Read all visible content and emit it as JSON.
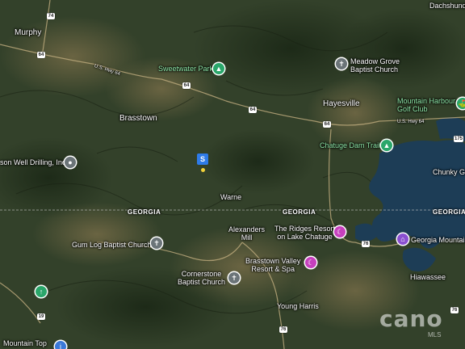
{
  "map": {
    "places": {
      "dachshund": "Dachshund",
      "murphy": "Murphy",
      "brasstown": "Brasstown",
      "hayesville": "Hayesville",
      "warne": "Warne",
      "alexanders_mill": "Alexanders\nMill",
      "young_harris": "Young Harris",
      "hiawassee": "Hiawassee",
      "chunky_gal": "Chunky Ga",
      "mountain_top": "Mountain Top"
    },
    "states": {
      "georgia_left": "GEORGIA",
      "georgia_mid": "GEORGIA",
      "georgia_right": "GEORGIA"
    },
    "roads": {
      "us64_left": "U.S. Hwy 64",
      "us64_right": "U.S. Hwy 64",
      "shield_74": "74",
      "shield_64a": "64",
      "shield_64b": "64",
      "shield_64c": "64",
      "shield_64d": "64",
      "shield_175": "175",
      "shield_76a": "76",
      "shield_76b": "76",
      "shield_76c": "76",
      "shield_19": "19"
    },
    "pois": {
      "sweetwater_park": "Sweetwater Park",
      "meadow_grove": "Meadow Grove\nBaptist Church",
      "mountain_harbour": "Mountain Harbour\nGolf Club",
      "chatuge_dam_trail": "Chatuge Dam Trail",
      "well_drilling": "son Well Drilling, Inc",
      "the_ridges_resort": "The Ridges Resort\non Lake Chatuge",
      "georgia_mountain": "Georgia Mountain",
      "gum_log_church": "Gum Log Baptist Church",
      "cornerstone_church": "Cornerstone\nBaptist Church",
      "brasstown_valley": "Brasstown Valley\nResort & Spa"
    },
    "marker_label": "S",
    "watermark": "cano",
    "watermark_sub": "MLS",
    "colors": {
      "lake": "#1d3d56",
      "terrain_dark": "#2a3522",
      "terrain_light": "#5b5a3c"
    }
  }
}
